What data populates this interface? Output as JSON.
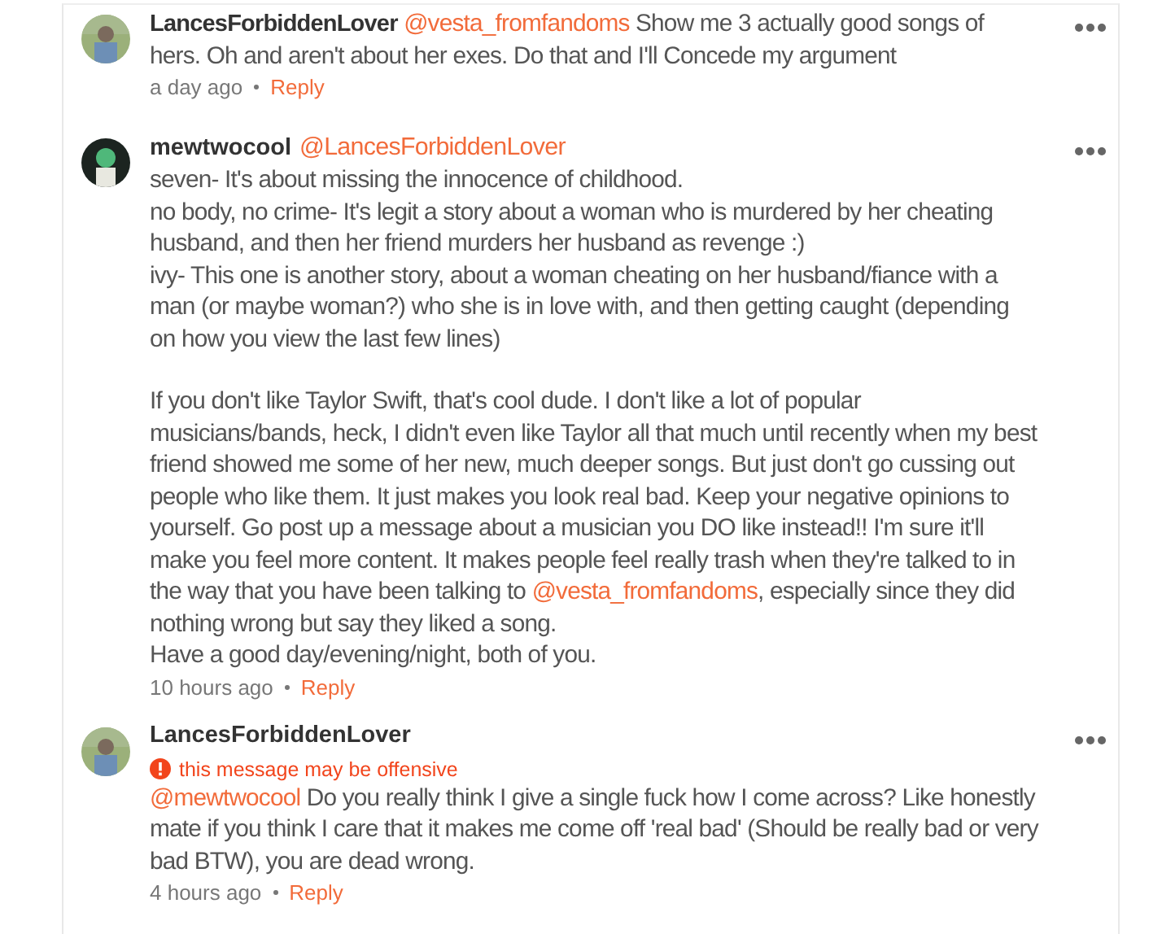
{
  "comments": [
    {
      "author": "LancesForbiddenLover",
      "paragraphs": [
        [
          {
            "kind": "mention",
            "text": "@vesta_fromfandoms"
          },
          {
            "kind": "text",
            "text": " Show me 3 actually good songs of hers. Oh and aren't about her exes. Do that and I'll Concede my argument"
          }
        ]
      ],
      "time": "a day ago",
      "reply": "Reply"
    },
    {
      "author": "mewtwocool",
      "mention": "@LancesForbiddenLover",
      "paragraphs": [
        [
          {
            "kind": "text",
            "text": "seven- It's about missing the innocence of childhood."
          }
        ],
        [
          {
            "kind": "text",
            "text": "no body, no crime- It's legit a story about a woman who is murdered by her cheating husband, and then her friend murders her husband as revenge :)"
          }
        ],
        [
          {
            "kind": "text",
            "text": "ivy- This one is another story, about a woman cheating on her husband/fiance with a man (or maybe woman?) who she is in love with, and then getting caught (depending on how you view the last few lines)"
          }
        ],
        [
          {
            "kind": "text",
            "text": "If you don't like Taylor Swift, that's cool dude. I don't like a lot of popular musicians/bands, heck, I didn't even like Taylor all that much until recently when my best friend showed me some of her new, much deeper songs. But just don't go cussing out people who like them. It just makes you look real bad. Keep your negative opinions to yourself. Go post up a message about a musician you DO like instead!! I'm sure it'll make you feel more content. It makes people feel really trash when they're talked to in the way that you have been talking to "
          },
          {
            "kind": "mention",
            "text": "@vesta_fromfandoms"
          },
          {
            "kind": "text",
            "text": ", especially since they did nothing wrong but say they liked a song."
          }
        ],
        [
          {
            "kind": "text",
            "text": "Have a good day/evening/night, both of you."
          }
        ]
      ],
      "time": "10 hours ago",
      "reply": "Reply"
    },
    {
      "author": "LancesForbiddenLover",
      "warning": "this message may be offensive",
      "paragraphs": [
        [
          {
            "kind": "mention",
            "text": "@mewtwocool"
          },
          {
            "kind": "text",
            "text": " Do you really think I give a single fuck how I come across? Like honestly mate if you think I care that it makes me come off 'real bad' (Should be really bad or very bad BTW), you are dead wrong."
          }
        ]
      ],
      "time": "4 hours ago",
      "reply": "Reply"
    }
  ]
}
